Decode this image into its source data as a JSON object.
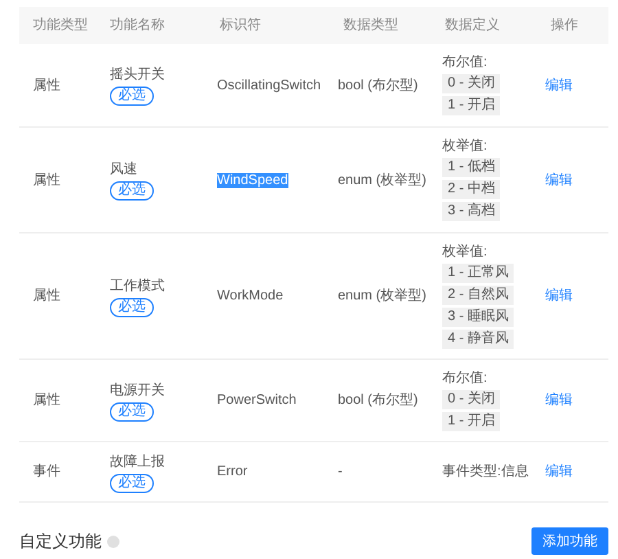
{
  "columns": [
    "功能类型",
    "功能名称",
    "标识符",
    "数据类型",
    "数据定义",
    "操作"
  ],
  "rows": [
    {
      "type": "属性",
      "name": "摇头开关",
      "badge": "必选",
      "identifier": "OscillatingSwitch",
      "highlighted": false,
      "data_type": "bool (布尔型)",
      "definition": {
        "kind": "options",
        "label": "布尔值:",
        "options": [
          "0 - 关闭",
          "1 - 开启"
        ]
      },
      "action": "编辑"
    },
    {
      "type": "属性",
      "name": "风速",
      "badge": "必选",
      "identifier": "WindSpeed",
      "highlighted": true,
      "data_type": "enum (枚举型)",
      "definition": {
        "kind": "options",
        "label": "枚举值:",
        "options": [
          "1 - 低档",
          "2 - 中档",
          "3 - 高档"
        ]
      },
      "action": "编辑"
    },
    {
      "type": "属性",
      "name": "工作模式",
      "badge": "必选",
      "identifier": "WorkMode",
      "highlighted": false,
      "data_type": "enum (枚举型)",
      "definition": {
        "kind": "options",
        "label": "枚举值:",
        "options": [
          "1 - 正常风",
          "2 - 自然风",
          "3 - 睡眠风",
          "4 - 静音风"
        ]
      },
      "action": "编辑"
    },
    {
      "type": "属性",
      "name": "电源开关",
      "badge": "必选",
      "identifier": "PowerSwitch",
      "highlighted": false,
      "data_type": "bool (布尔型)",
      "definition": {
        "kind": "options",
        "label": "布尔值:",
        "options": [
          "0 - 关闭",
          "1 - 开启"
        ]
      },
      "action": "编辑"
    },
    {
      "type": "事件",
      "name": "故障上报",
      "badge": "必选",
      "identifier": "Error",
      "highlighted": false,
      "data_type": "-",
      "definition": {
        "kind": "text",
        "text": "事件类型:信息"
      },
      "action": "编辑"
    }
  ],
  "footer": {
    "title": "自定义功能",
    "button": "添加功能"
  }
}
